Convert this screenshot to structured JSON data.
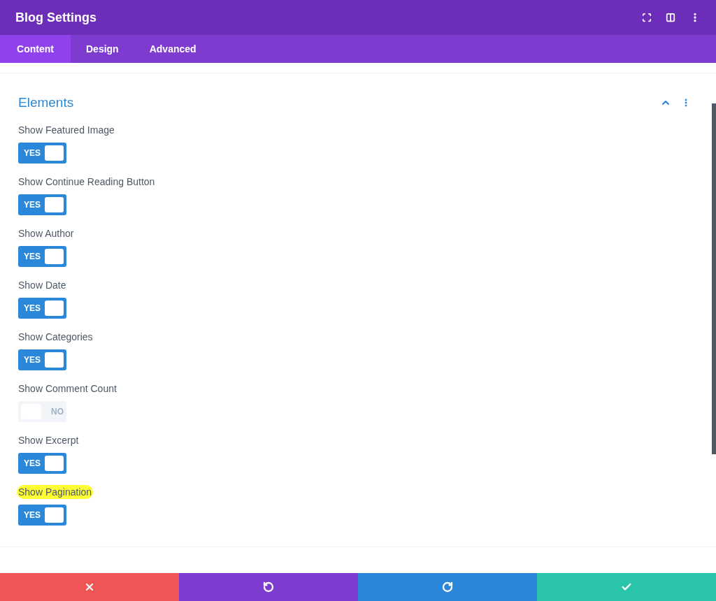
{
  "window": {
    "title": "Blog Settings"
  },
  "tabs": [
    {
      "label": "Content",
      "selected": true
    },
    {
      "label": "Design",
      "selected": false
    },
    {
      "label": "Advanced",
      "selected": false
    }
  ],
  "section": {
    "title": "Elements",
    "expanded": true
  },
  "toggles": [
    {
      "label": "Show Featured Image",
      "on": true,
      "highlighted": false,
      "text": "YES"
    },
    {
      "label": "Show Continue Reading Button",
      "on": true,
      "highlighted": false,
      "text": "YES"
    },
    {
      "label": "Show Author",
      "on": true,
      "highlighted": false,
      "text": "YES"
    },
    {
      "label": "Show Date",
      "on": true,
      "highlighted": false,
      "text": "YES"
    },
    {
      "label": "Show Categories",
      "on": true,
      "highlighted": false,
      "text": "YES"
    },
    {
      "label": "Show Comment Count",
      "on": false,
      "highlighted": false,
      "text": "NO"
    },
    {
      "label": "Show Excerpt",
      "on": true,
      "highlighted": false,
      "text": "YES"
    },
    {
      "label": "Show Pagination",
      "on": true,
      "highlighted": true,
      "text": "YES"
    }
  ],
  "footer": [
    {
      "kind": "cancel"
    },
    {
      "kind": "undo"
    },
    {
      "kind": "redo"
    },
    {
      "kind": "save"
    }
  ]
}
